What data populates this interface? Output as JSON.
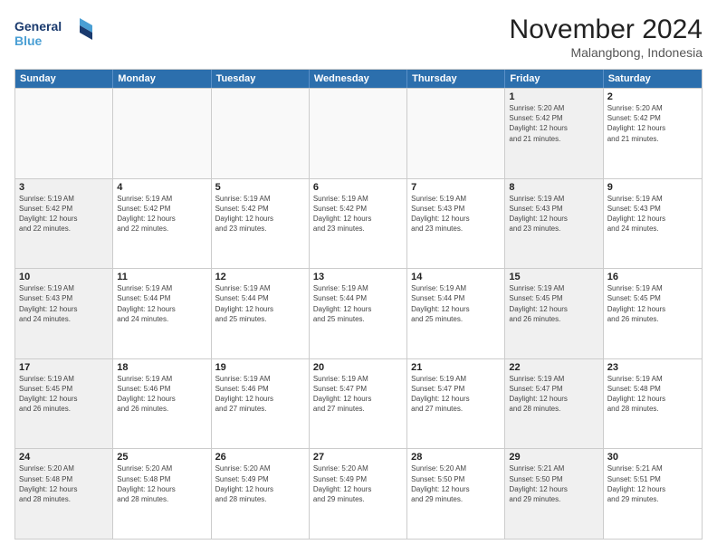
{
  "logo": {
    "line1": "General",
    "line2": "Blue"
  },
  "title": "November 2024",
  "location": "Malangbong, Indonesia",
  "header_days": [
    "Sunday",
    "Monday",
    "Tuesday",
    "Wednesday",
    "Thursday",
    "Friday",
    "Saturday"
  ],
  "rows": [
    [
      {
        "day": "",
        "detail": "",
        "empty": true
      },
      {
        "day": "",
        "detail": "",
        "empty": true
      },
      {
        "day": "",
        "detail": "",
        "empty": true
      },
      {
        "day": "",
        "detail": "",
        "empty": true
      },
      {
        "day": "",
        "detail": "",
        "empty": true
      },
      {
        "day": "1",
        "detail": "Sunrise: 5:20 AM\nSunset: 5:42 PM\nDaylight: 12 hours\nand 21 minutes.",
        "shaded": true
      },
      {
        "day": "2",
        "detail": "Sunrise: 5:20 AM\nSunset: 5:42 PM\nDaylight: 12 hours\nand 21 minutes.",
        "shaded": false
      }
    ],
    [
      {
        "day": "3",
        "detail": "Sunrise: 5:19 AM\nSunset: 5:42 PM\nDaylight: 12 hours\nand 22 minutes.",
        "shaded": true
      },
      {
        "day": "4",
        "detail": "Sunrise: 5:19 AM\nSunset: 5:42 PM\nDaylight: 12 hours\nand 22 minutes.",
        "shaded": false
      },
      {
        "day": "5",
        "detail": "Sunrise: 5:19 AM\nSunset: 5:42 PM\nDaylight: 12 hours\nand 23 minutes.",
        "shaded": false
      },
      {
        "day": "6",
        "detail": "Sunrise: 5:19 AM\nSunset: 5:42 PM\nDaylight: 12 hours\nand 23 minutes.",
        "shaded": false
      },
      {
        "day": "7",
        "detail": "Sunrise: 5:19 AM\nSunset: 5:43 PM\nDaylight: 12 hours\nand 23 minutes.",
        "shaded": false
      },
      {
        "day": "8",
        "detail": "Sunrise: 5:19 AM\nSunset: 5:43 PM\nDaylight: 12 hours\nand 23 minutes.",
        "shaded": true
      },
      {
        "day": "9",
        "detail": "Sunrise: 5:19 AM\nSunset: 5:43 PM\nDaylight: 12 hours\nand 24 minutes.",
        "shaded": false
      }
    ],
    [
      {
        "day": "10",
        "detail": "Sunrise: 5:19 AM\nSunset: 5:43 PM\nDaylight: 12 hours\nand 24 minutes.",
        "shaded": true
      },
      {
        "day": "11",
        "detail": "Sunrise: 5:19 AM\nSunset: 5:44 PM\nDaylight: 12 hours\nand 24 minutes.",
        "shaded": false
      },
      {
        "day": "12",
        "detail": "Sunrise: 5:19 AM\nSunset: 5:44 PM\nDaylight: 12 hours\nand 25 minutes.",
        "shaded": false
      },
      {
        "day": "13",
        "detail": "Sunrise: 5:19 AM\nSunset: 5:44 PM\nDaylight: 12 hours\nand 25 minutes.",
        "shaded": false
      },
      {
        "day": "14",
        "detail": "Sunrise: 5:19 AM\nSunset: 5:44 PM\nDaylight: 12 hours\nand 25 minutes.",
        "shaded": false
      },
      {
        "day": "15",
        "detail": "Sunrise: 5:19 AM\nSunset: 5:45 PM\nDaylight: 12 hours\nand 26 minutes.",
        "shaded": true
      },
      {
        "day": "16",
        "detail": "Sunrise: 5:19 AM\nSunset: 5:45 PM\nDaylight: 12 hours\nand 26 minutes.",
        "shaded": false
      }
    ],
    [
      {
        "day": "17",
        "detail": "Sunrise: 5:19 AM\nSunset: 5:45 PM\nDaylight: 12 hours\nand 26 minutes.",
        "shaded": true
      },
      {
        "day": "18",
        "detail": "Sunrise: 5:19 AM\nSunset: 5:46 PM\nDaylight: 12 hours\nand 26 minutes.",
        "shaded": false
      },
      {
        "day": "19",
        "detail": "Sunrise: 5:19 AM\nSunset: 5:46 PM\nDaylight: 12 hours\nand 27 minutes.",
        "shaded": false
      },
      {
        "day": "20",
        "detail": "Sunrise: 5:19 AM\nSunset: 5:47 PM\nDaylight: 12 hours\nand 27 minutes.",
        "shaded": false
      },
      {
        "day": "21",
        "detail": "Sunrise: 5:19 AM\nSunset: 5:47 PM\nDaylight: 12 hours\nand 27 minutes.",
        "shaded": false
      },
      {
        "day": "22",
        "detail": "Sunrise: 5:19 AM\nSunset: 5:47 PM\nDaylight: 12 hours\nand 28 minutes.",
        "shaded": true
      },
      {
        "day": "23",
        "detail": "Sunrise: 5:19 AM\nSunset: 5:48 PM\nDaylight: 12 hours\nand 28 minutes.",
        "shaded": false
      }
    ],
    [
      {
        "day": "24",
        "detail": "Sunrise: 5:20 AM\nSunset: 5:48 PM\nDaylight: 12 hours\nand 28 minutes.",
        "shaded": true
      },
      {
        "day": "25",
        "detail": "Sunrise: 5:20 AM\nSunset: 5:48 PM\nDaylight: 12 hours\nand 28 minutes.",
        "shaded": false
      },
      {
        "day": "26",
        "detail": "Sunrise: 5:20 AM\nSunset: 5:49 PM\nDaylight: 12 hours\nand 28 minutes.",
        "shaded": false
      },
      {
        "day": "27",
        "detail": "Sunrise: 5:20 AM\nSunset: 5:49 PM\nDaylight: 12 hours\nand 29 minutes.",
        "shaded": false
      },
      {
        "day": "28",
        "detail": "Sunrise: 5:20 AM\nSunset: 5:50 PM\nDaylight: 12 hours\nand 29 minutes.",
        "shaded": false
      },
      {
        "day": "29",
        "detail": "Sunrise: 5:21 AM\nSunset: 5:50 PM\nDaylight: 12 hours\nand 29 minutes.",
        "shaded": true
      },
      {
        "day": "30",
        "detail": "Sunrise: 5:21 AM\nSunset: 5:51 PM\nDaylight: 12 hours\nand 29 minutes.",
        "shaded": false
      }
    ]
  ]
}
